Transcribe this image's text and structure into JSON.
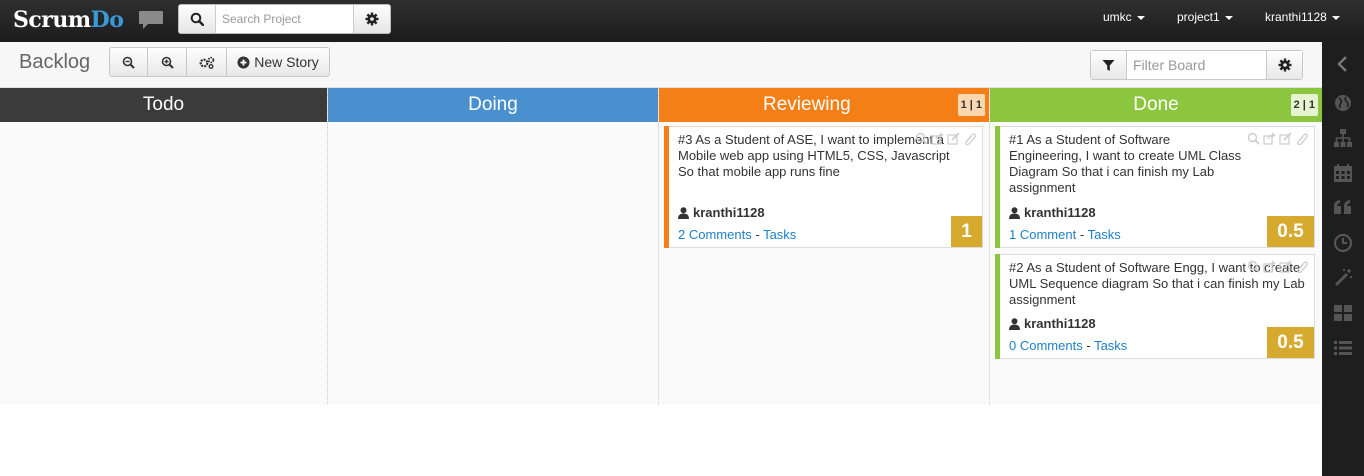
{
  "app": {
    "logo_main": "Scrum",
    "logo_accent": "Do"
  },
  "search": {
    "placeholder": "Search Project"
  },
  "topnav": {
    "org": "umkc",
    "project": "project1",
    "user": "kranthi1128"
  },
  "toolbar": {
    "title": "Backlog",
    "new_story_label": "New Story",
    "filter_placeholder": "Filter Board"
  },
  "columns": [
    {
      "title": "Todo",
      "color": "#3b3b3b"
    },
    {
      "title": "Doing",
      "color": "#4a90cf"
    },
    {
      "title": "Reviewing",
      "color": "#f47f16",
      "count": "1 | 1"
    },
    {
      "title": "Done",
      "color": "#8cc63f",
      "count": "2 | 1"
    }
  ],
  "cards": [
    {
      "title": "#3 As a Student of ASE, I want to implement a Mobile web app using HTML5, CSS, Javascript So that mobile app runs fine",
      "user": "kranthi1128",
      "comments": "2 Comments",
      "sep": "-",
      "tasks": "Tasks",
      "points": "1",
      "accent": "#f47f16"
    },
    {
      "title": "#1 As a Student of Software Engineering, I want to create UML Class Diagram So that i can finish my Lab assignment",
      "user": "kranthi1128",
      "comments": "1 Comment",
      "sep": "-",
      "tasks": "Tasks",
      "points": "0.5",
      "accent": "#8cc63f"
    },
    {
      "title": "#2 As a Student of Software Engg, I want to create UML Sequence diagram So that i can finish my Lab assignment",
      "user": "kranthi1128",
      "comments": "0 Comments",
      "sep": "-",
      "tasks": "Tasks",
      "points": "0.5",
      "accent": "#8cc63f"
    }
  ]
}
